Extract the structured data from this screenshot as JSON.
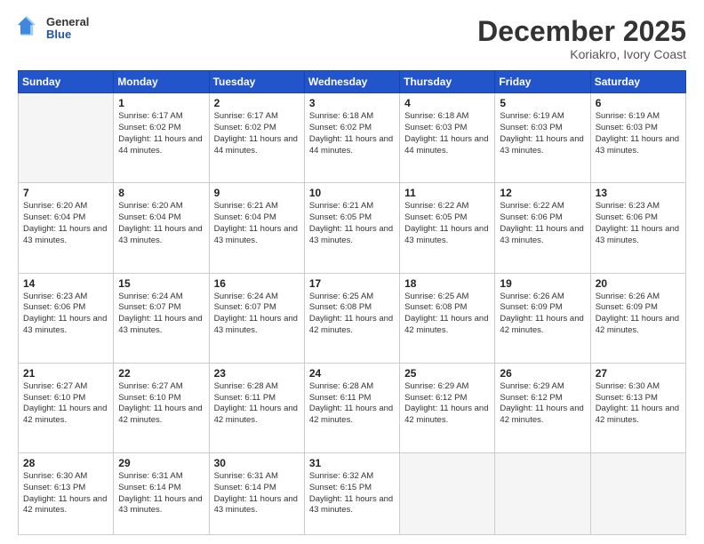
{
  "logo": {
    "general": "General",
    "blue": "Blue"
  },
  "header": {
    "month": "December 2025",
    "location": "Koriakro, Ivory Coast"
  },
  "days": {
    "headers": [
      "Sunday",
      "Monday",
      "Tuesday",
      "Wednesday",
      "Thursday",
      "Friday",
      "Saturday"
    ]
  },
  "weeks": [
    {
      "cells": [
        {
          "day": "",
          "empty": true
        },
        {
          "day": "1",
          "sunrise": "6:17 AM",
          "sunset": "6:02 PM",
          "daylight": "11 hours and 44 minutes."
        },
        {
          "day": "2",
          "sunrise": "6:17 AM",
          "sunset": "6:02 PM",
          "daylight": "11 hours and 44 minutes."
        },
        {
          "day": "3",
          "sunrise": "6:18 AM",
          "sunset": "6:02 PM",
          "daylight": "11 hours and 44 minutes."
        },
        {
          "day": "4",
          "sunrise": "6:18 AM",
          "sunset": "6:03 PM",
          "daylight": "11 hours and 44 minutes."
        },
        {
          "day": "5",
          "sunrise": "6:19 AM",
          "sunset": "6:03 PM",
          "daylight": "11 hours and 43 minutes."
        },
        {
          "day": "6",
          "sunrise": "6:19 AM",
          "sunset": "6:03 PM",
          "daylight": "11 hours and 43 minutes."
        }
      ]
    },
    {
      "cells": [
        {
          "day": "7",
          "sunrise": "6:20 AM",
          "sunset": "6:04 PM",
          "daylight": "11 hours and 43 minutes."
        },
        {
          "day": "8",
          "sunrise": "6:20 AM",
          "sunset": "6:04 PM",
          "daylight": "11 hours and 43 minutes."
        },
        {
          "day": "9",
          "sunrise": "6:21 AM",
          "sunset": "6:04 PM",
          "daylight": "11 hours and 43 minutes."
        },
        {
          "day": "10",
          "sunrise": "6:21 AM",
          "sunset": "6:05 PM",
          "daylight": "11 hours and 43 minutes."
        },
        {
          "day": "11",
          "sunrise": "6:22 AM",
          "sunset": "6:05 PM",
          "daylight": "11 hours and 43 minutes."
        },
        {
          "day": "12",
          "sunrise": "6:22 AM",
          "sunset": "6:06 PM",
          "daylight": "11 hours and 43 minutes."
        },
        {
          "day": "13",
          "sunrise": "6:23 AM",
          "sunset": "6:06 PM",
          "daylight": "11 hours and 43 minutes."
        }
      ]
    },
    {
      "cells": [
        {
          "day": "14",
          "sunrise": "6:23 AM",
          "sunset": "6:06 PM",
          "daylight": "11 hours and 43 minutes."
        },
        {
          "day": "15",
          "sunrise": "6:24 AM",
          "sunset": "6:07 PM",
          "daylight": "11 hours and 43 minutes."
        },
        {
          "day": "16",
          "sunrise": "6:24 AM",
          "sunset": "6:07 PM",
          "daylight": "11 hours and 43 minutes."
        },
        {
          "day": "17",
          "sunrise": "6:25 AM",
          "sunset": "6:08 PM",
          "daylight": "11 hours and 42 minutes."
        },
        {
          "day": "18",
          "sunrise": "6:25 AM",
          "sunset": "6:08 PM",
          "daylight": "11 hours and 42 minutes."
        },
        {
          "day": "19",
          "sunrise": "6:26 AM",
          "sunset": "6:09 PM",
          "daylight": "11 hours and 42 minutes."
        },
        {
          "day": "20",
          "sunrise": "6:26 AM",
          "sunset": "6:09 PM",
          "daylight": "11 hours and 42 minutes."
        }
      ]
    },
    {
      "cells": [
        {
          "day": "21",
          "sunrise": "6:27 AM",
          "sunset": "6:10 PM",
          "daylight": "11 hours and 42 minutes."
        },
        {
          "day": "22",
          "sunrise": "6:27 AM",
          "sunset": "6:10 PM",
          "daylight": "11 hours and 42 minutes."
        },
        {
          "day": "23",
          "sunrise": "6:28 AM",
          "sunset": "6:11 PM",
          "daylight": "11 hours and 42 minutes."
        },
        {
          "day": "24",
          "sunrise": "6:28 AM",
          "sunset": "6:11 PM",
          "daylight": "11 hours and 42 minutes."
        },
        {
          "day": "25",
          "sunrise": "6:29 AM",
          "sunset": "6:12 PM",
          "daylight": "11 hours and 42 minutes."
        },
        {
          "day": "26",
          "sunrise": "6:29 AM",
          "sunset": "6:12 PM",
          "daylight": "11 hours and 42 minutes."
        },
        {
          "day": "27",
          "sunrise": "6:30 AM",
          "sunset": "6:13 PM",
          "daylight": "11 hours and 42 minutes."
        }
      ]
    },
    {
      "cells": [
        {
          "day": "28",
          "sunrise": "6:30 AM",
          "sunset": "6:13 PM",
          "daylight": "11 hours and 42 minutes."
        },
        {
          "day": "29",
          "sunrise": "6:31 AM",
          "sunset": "6:14 PM",
          "daylight": "11 hours and 43 minutes."
        },
        {
          "day": "30",
          "sunrise": "6:31 AM",
          "sunset": "6:14 PM",
          "daylight": "11 hours and 43 minutes."
        },
        {
          "day": "31",
          "sunrise": "6:32 AM",
          "sunset": "6:15 PM",
          "daylight": "11 hours and 43 minutes."
        },
        {
          "day": "",
          "empty": true
        },
        {
          "day": "",
          "empty": true
        },
        {
          "day": "",
          "empty": true
        }
      ]
    }
  ],
  "labels": {
    "sunrise": "Sunrise:",
    "sunset": "Sunset:",
    "daylight": "Daylight:"
  }
}
